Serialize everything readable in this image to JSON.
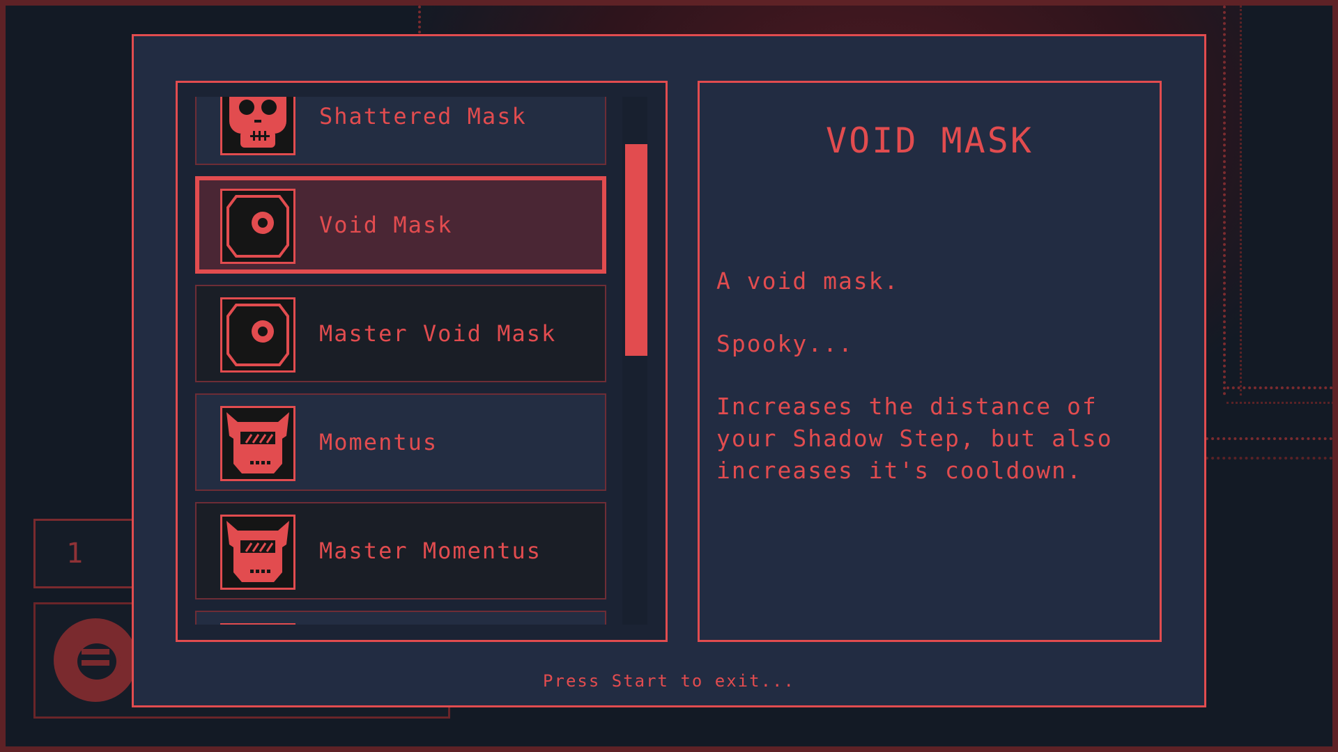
{
  "hud": {
    "counter_value": "1"
  },
  "item_list": {
    "items": [
      {
        "label": "Shattered Mask",
        "icon": "skull-icon"
      },
      {
        "label": "Void Mask",
        "icon": "void-eye-icon",
        "selected": true
      },
      {
        "label": "Master Void Mask",
        "icon": "void-eye-icon"
      },
      {
        "label": "Momentus",
        "icon": "horned-visor-icon"
      },
      {
        "label": "Master Momentus",
        "icon": "horned-visor-icon"
      }
    ],
    "scroll_position": 0.15
  },
  "detail": {
    "title": "VOID MASK",
    "line1": "A void mask.",
    "line2": "Spooky...",
    "line3": "Increases the distance of your Shadow Step, but also increases it's cooldown."
  },
  "footer": {
    "hint": "Press Start to exit..."
  },
  "colors": {
    "accent": "#e24c4f",
    "panel": "#222c42",
    "background": "#131a25",
    "selected_fill": "#4a2634"
  }
}
